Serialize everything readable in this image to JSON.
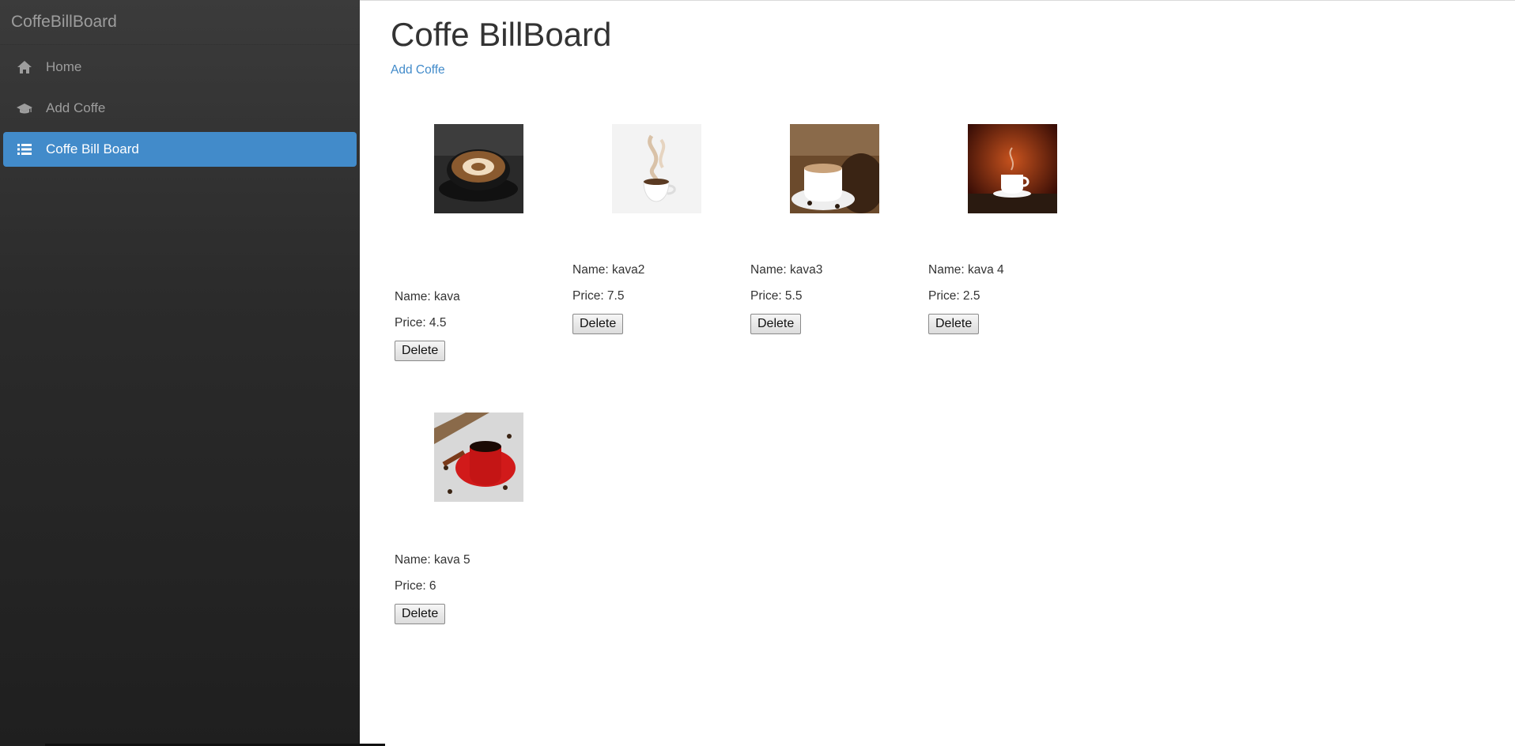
{
  "sidebar": {
    "brand": "CoffeBillBoard",
    "items": [
      {
        "label": "Home",
        "icon": "home-icon"
      },
      {
        "label": "Add Coffe",
        "icon": "graduation-cap-icon"
      },
      {
        "label": "Coffe Bill Board",
        "icon": "list-icon",
        "active": true
      }
    ]
  },
  "main": {
    "title": "Coffe BillBoard",
    "add_link": "Add Coffe",
    "delete_label": "Delete",
    "coffees": [
      {
        "name": "Name: kava",
        "price": "Price: 4.5"
      },
      {
        "name": "Name: kava2",
        "price": "Price: 7.5"
      },
      {
        "name": "Name: kava3",
        "price": "Price: 5.5"
      },
      {
        "name": "Name: kava 4",
        "price": "Price: 2.5"
      },
      {
        "name": "Name: kava 5",
        "price": "Price: 6"
      }
    ]
  },
  "colors": {
    "accent": "#428bca",
    "sidebar_bg": "#2b2b2b",
    "muted_text": "#9d9d9d"
  }
}
